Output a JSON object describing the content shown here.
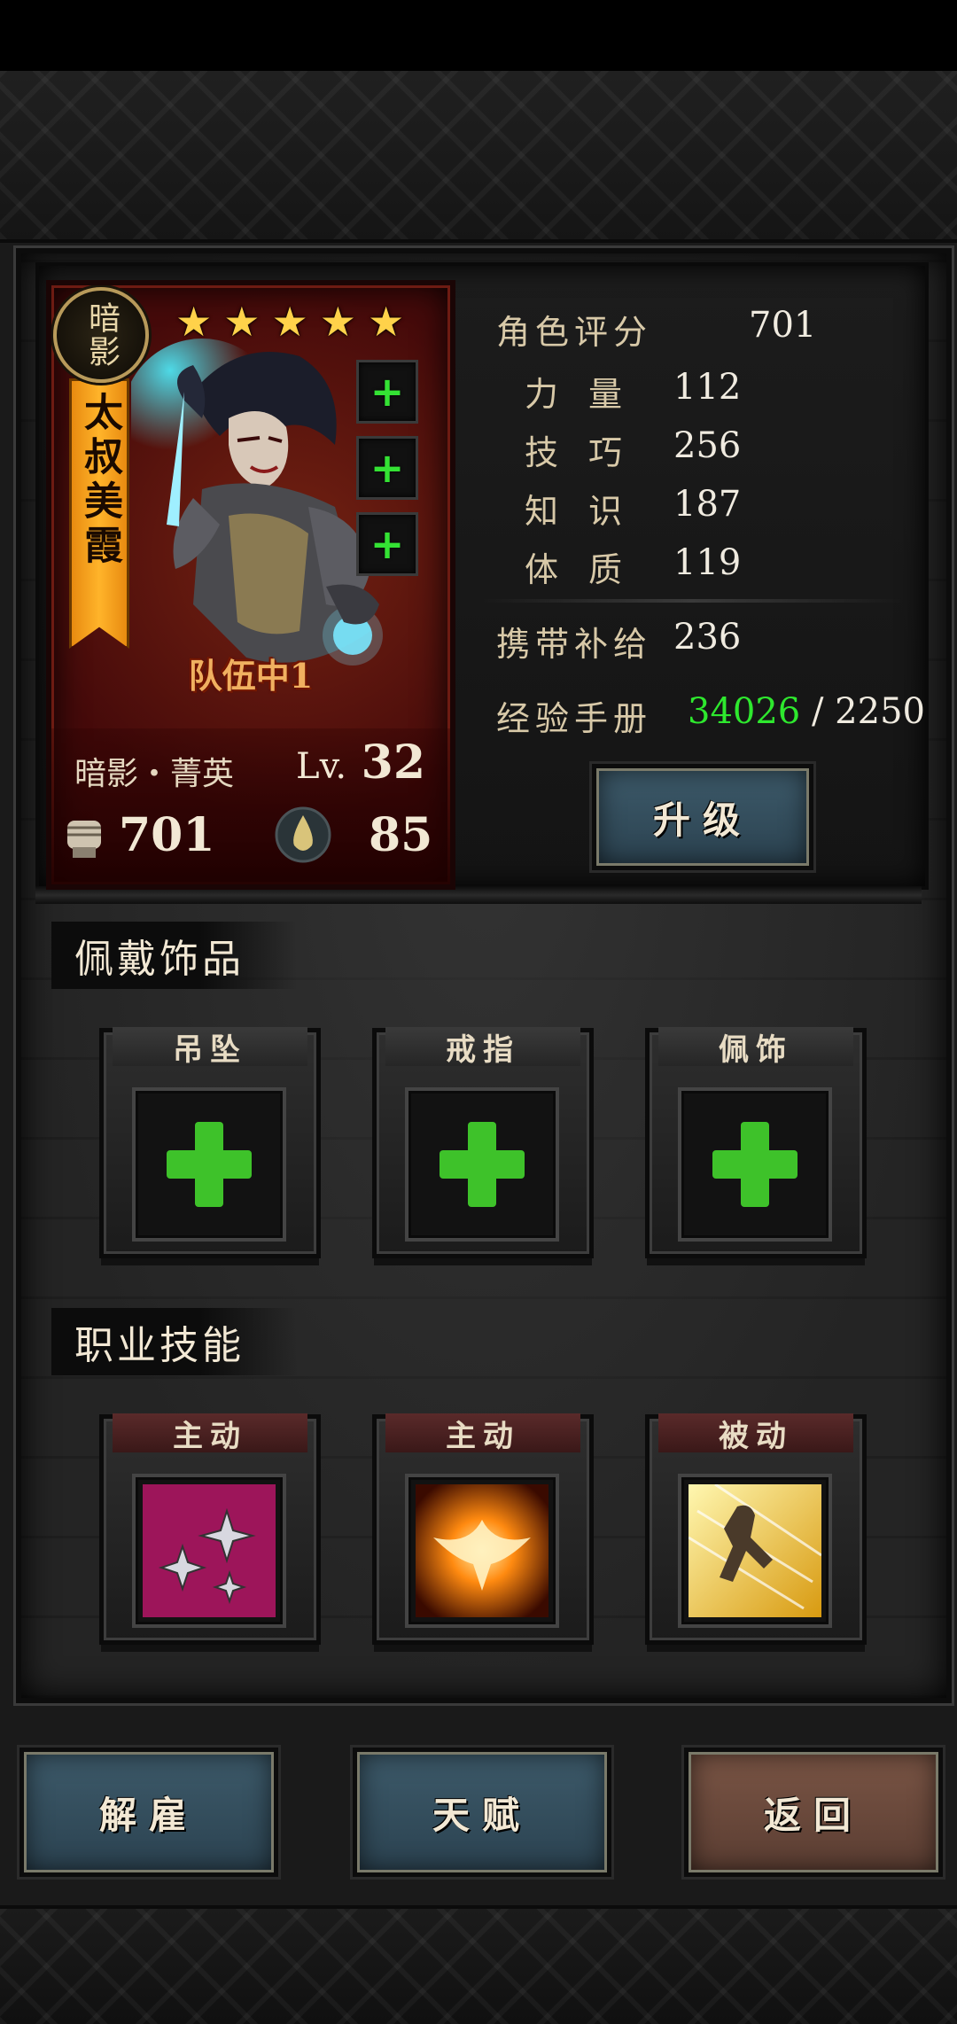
{
  "character": {
    "class_badge": "暗影",
    "name": "太叔美霞",
    "star_count": 5,
    "team_status": "队伍中1",
    "rank": "暗影・菁英",
    "level_prefix": "Lv.",
    "level": "32",
    "power": "701",
    "willpower": "85",
    "equip_slots": 3
  },
  "stats": {
    "rating_label": "角色评分",
    "rating_value": "701",
    "strength_label": "力量",
    "strength_value": "112",
    "skill_label": "技巧",
    "skill_value": "256",
    "knowledge_label": "知识",
    "knowledge_value": "187",
    "constitution_label": "体质",
    "constitution_value": "119",
    "supply_label": "携带补给",
    "supply_value": "236",
    "exp_label": "经验手册",
    "exp_current": "34026",
    "exp_separator": "/",
    "exp_required": "2250"
  },
  "buttons": {
    "upgrade": "升级",
    "dismiss": "解雇",
    "talent": "天赋",
    "back": "返回"
  },
  "accessories": {
    "title": "佩戴饰品",
    "slots": [
      "吊坠",
      "戒指",
      "佩饰"
    ]
  },
  "skills": {
    "title": "职业技能",
    "items": [
      {
        "type": "主动",
        "icon": "shuriken-skill-icon",
        "color": "#e0207a"
      },
      {
        "type": "主动",
        "icon": "phoenix-skill-icon",
        "color": "#ff7a10"
      },
      {
        "type": "被动",
        "icon": "dash-skill-icon",
        "color": "#f0c020"
      }
    ]
  },
  "colors": {
    "exp_current": "#2ee82e",
    "star": "#ffd24a",
    "plus": "#3ec22a"
  }
}
